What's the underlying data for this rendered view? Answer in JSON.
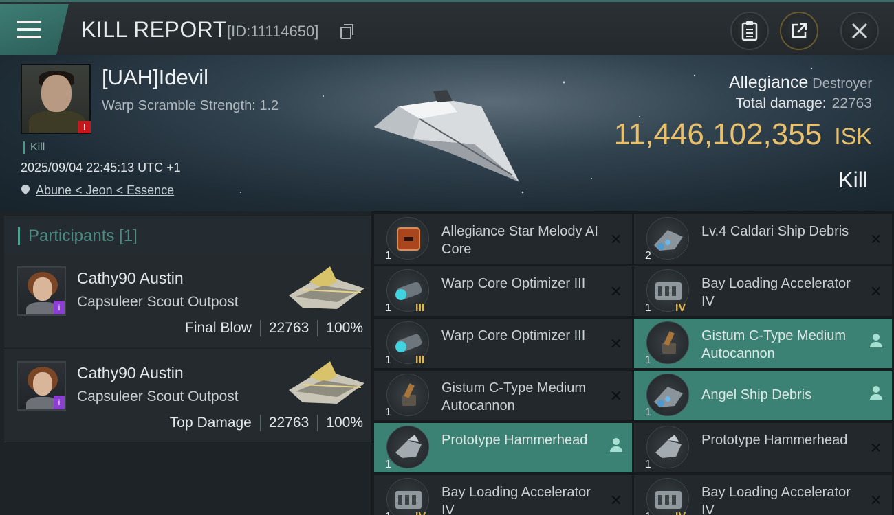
{
  "header": {
    "title": "KILL REPORT",
    "report_id": "[ID:11114650]"
  },
  "victim": {
    "name": "[UAH]Idevil",
    "warp_scramble": "Warp Scramble Strength: 1.2",
    "tag": "Kill",
    "datetime": "2025/09/04 22:45:13 UTC +1",
    "location": "Abune < Jeon < Essence",
    "alert": "!"
  },
  "summary": {
    "ship_name": "Allegiance",
    "ship_class": "Destroyer",
    "damage_label": "Total damage:",
    "damage_value": "22763",
    "isk_value": "11,446,102,355",
    "isk_unit": "ISK",
    "result": "Kill"
  },
  "participants": {
    "header": "Participants [1]",
    "rows": [
      {
        "name": "Cathy90 Austin",
        "ship": "Capsuleer Scout Outpost",
        "role": "Final Blow",
        "damage": "22763",
        "percent": "100%",
        "badge": "i"
      },
      {
        "name": "Cathy90 Austin",
        "ship": "Capsuleer Scout Outpost",
        "role": "Top Damage",
        "damage": "22763",
        "percent": "100%",
        "badge": "i"
      }
    ]
  },
  "items": [
    {
      "name": "Allegiance Star Melody AI Core",
      "qty": "1",
      "tier": "",
      "highlight": false,
      "action": "x",
      "icon": "ai-core-icon"
    },
    {
      "name": "Lv.4 Caldari Ship Debris",
      "qty": "2",
      "tier": "",
      "highlight": false,
      "action": "x",
      "icon": "ship-debris-icon"
    },
    {
      "name": "Warp Core Optimizer III",
      "qty": "1",
      "tier": "III",
      "highlight": false,
      "action": "x",
      "icon": "warp-core-icon"
    },
    {
      "name": "Bay Loading Accelerator IV",
      "qty": "1",
      "tier": "IV",
      "highlight": false,
      "action": "x",
      "icon": "bay-loading-icon"
    },
    {
      "name": "Warp Core Optimizer III",
      "qty": "1",
      "tier": "III",
      "highlight": false,
      "action": "x",
      "icon": "warp-core-icon"
    },
    {
      "name": "Gistum C-Type Medium Autocannon",
      "qty": "1",
      "tier": "",
      "highlight": true,
      "action": "person",
      "icon": "autocannon-icon"
    },
    {
      "name": "Gistum C-Type Medium Autocannon",
      "qty": "1",
      "tier": "",
      "highlight": false,
      "action": "x",
      "icon": "autocannon-icon"
    },
    {
      "name": "Angel Ship Debris",
      "qty": "1",
      "tier": "",
      "highlight": true,
      "action": "person",
      "icon": "ship-debris-icon"
    },
    {
      "name": "Prototype Hammerhead",
      "qty": "1",
      "tier": "",
      "highlight": true,
      "action": "person",
      "icon": "drone-icon"
    },
    {
      "name": "Prototype Hammerhead",
      "qty": "1",
      "tier": "",
      "highlight": false,
      "action": "x",
      "icon": "drone-icon"
    },
    {
      "name": "Bay Loading Accelerator IV",
      "qty": "1",
      "tier": "IV",
      "highlight": false,
      "action": "x",
      "icon": "bay-loading-icon"
    },
    {
      "name": "Bay Loading Accelerator IV",
      "qty": "1",
      "tier": "IV",
      "highlight": false,
      "action": "x",
      "icon": "bay-loading-icon"
    }
  ],
  "colors": {
    "accent": "#3b8274",
    "isk": "#e9c16d",
    "alert": "#c8161d",
    "tier": "#e5b74a"
  }
}
